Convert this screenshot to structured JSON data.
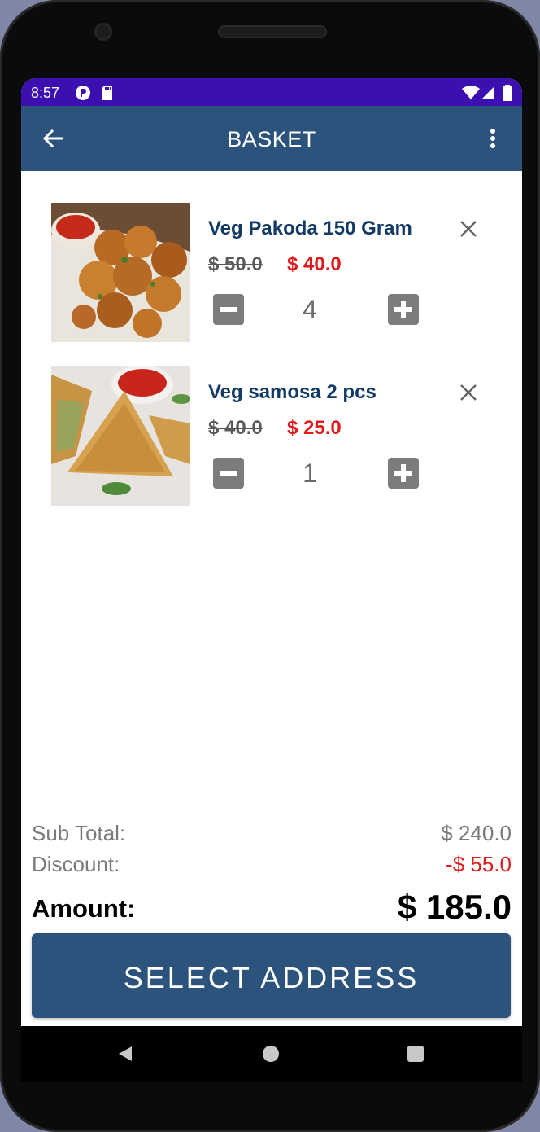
{
  "status_bar": {
    "time": "8:57",
    "icons": [
      "p-circle-icon",
      "sd-card-icon",
      "wifi-icon",
      "cellular-signal-icon",
      "battery-icon"
    ]
  },
  "app_bar": {
    "title": "BASKET",
    "back_icon": "arrow-back-icon",
    "menu_icon": "more-vertical-icon"
  },
  "items": [
    {
      "name": "Veg Pakoda 150 Gram",
      "old_price": "$ 50.0",
      "new_price": "$ 40.0",
      "quantity": "4",
      "image": "veg-pakoda-photo"
    },
    {
      "name": "Veg samosa 2 pcs",
      "old_price": "$ 40.0",
      "new_price": "$ 25.0",
      "quantity": "1",
      "image": "veg-samosa-photo"
    }
  ],
  "summary": {
    "subtotal_label": "Sub Total:",
    "subtotal_value": "$ 240.0",
    "discount_label": "Discount:",
    "discount_value": "-$ 55.0",
    "amount_label": "Amount:",
    "amount_value": "$ 185.0"
  },
  "cta": {
    "label": "SELECT ADDRESS"
  },
  "colors": {
    "status_bar": "#3b0fb0",
    "primary": "#2b537c",
    "price_red": "#e01b1b",
    "name_blue": "#123a64",
    "qty_button": "#7c7c7c"
  },
  "nav_bar": {
    "icons": [
      "nav-back-icon",
      "nav-home-icon",
      "nav-recents-icon"
    ]
  }
}
